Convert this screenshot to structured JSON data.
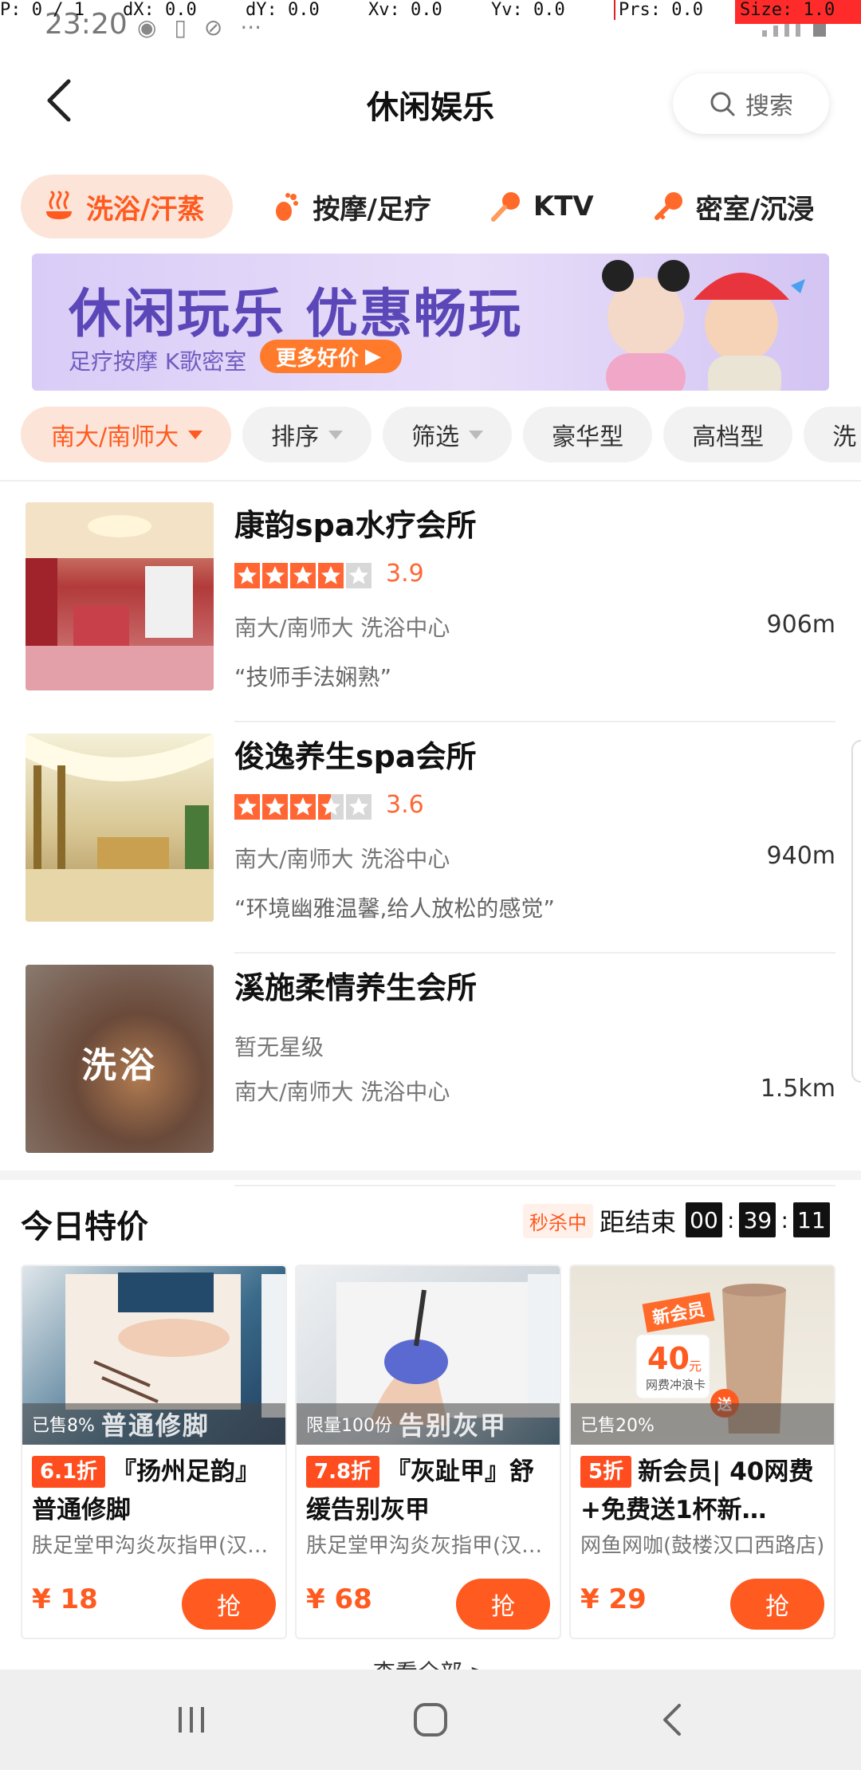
{
  "status_bar": {
    "time": "23:20",
    "debug": {
      "p": "P: 0 / 1",
      "dx": "dX: 0.0",
      "dy": "dY: 0.0",
      "xv": "Xv: 0.0",
      "yv": "Yv: 0.0",
      "prs": "Prs: 0.0",
      "size": "Size: 1.0"
    }
  },
  "header": {
    "title": "休闲娱乐",
    "search_label": "搜索"
  },
  "categories": [
    {
      "label": "洗浴/汗蒸",
      "icon": "bath-icon",
      "active": true
    },
    {
      "label": "按摩/足疗",
      "icon": "foot-icon",
      "active": false
    },
    {
      "label": "KTV",
      "icon": "microphone-icon",
      "active": false
    },
    {
      "label": "密室/沉浸",
      "icon": "key-icon",
      "active": false
    }
  ],
  "banner": {
    "headline": "休闲玩乐 优惠畅玩",
    "subline": "足疗按摩 K歌密室",
    "cta": "更多好价"
  },
  "filters": [
    {
      "label": "南大/南师大",
      "dropdown": true,
      "active": true
    },
    {
      "label": "排序",
      "dropdown": true,
      "active": false
    },
    {
      "label": "筛选",
      "dropdown": true,
      "active": false
    },
    {
      "label": "豪华型",
      "dropdown": false,
      "active": false
    },
    {
      "label": "高档型",
      "dropdown": false,
      "active": false
    },
    {
      "label": "洗",
      "dropdown": false,
      "active": false
    }
  ],
  "shops": [
    {
      "name": "康韵spa水疗会所",
      "rating": 3.9,
      "score": "3.9",
      "area": "南大/南师大",
      "category": "洗浴中心",
      "distance": "906m",
      "quote": "“技师手法娴熟”"
    },
    {
      "name": "俊逸养生spa会所",
      "rating": 3.6,
      "score": "3.6",
      "area": "南大/南师大",
      "category": "洗浴中心",
      "distance": "940m",
      "quote": "“环境幽雅温馨,给人放松的感觉”"
    },
    {
      "name": "溪施柔情养生会所",
      "no_rating": "暂无星级",
      "area": "南大/南师大",
      "category": "洗浴中心",
      "distance": "1.5km",
      "thumb_label": "洗浴"
    }
  ],
  "deals_section": {
    "title": "今日特价",
    "flash_tag": "秒杀中",
    "ends_label": "距结束",
    "countdown": [
      "00",
      "39",
      "11"
    ],
    "see_all": "查看全部 >"
  },
  "deals": [
    {
      "sold": "已售8%",
      "overlay": "普通修脚",
      "discount": "6.1折",
      "title": "『扬州足韵』普通修脚",
      "shop": "肤足堂甲沟炎灰指甲(汉…",
      "price": "¥ 18",
      "button": "抢"
    },
    {
      "sold": "限量100份",
      "overlay": "告别灰甲",
      "discount": "7.8折",
      "title": "『灰趾甲』舒缓告别灰甲",
      "shop": "肤足堂甲沟炎灰指甲(汉…",
      "price": "¥ 68",
      "button": "抢"
    },
    {
      "sold": "已售20%",
      "overlay": "",
      "discount": "5折",
      "title": "新会员| 40网费+免费送1杯新…",
      "shop": "网鱼网咖(鼓楼汉口西路店)",
      "price": "¥ 29",
      "button": "抢",
      "promo_badge": "新会员",
      "promo_amount": "40",
      "promo_unit": "元",
      "promo_desc": "网费冲浪卡",
      "promo_gift": "送"
    }
  ],
  "colors": {
    "accent": "#ff5a1f",
    "accent_light": "#fde4d8",
    "banner_text": "#5b47b8"
  }
}
